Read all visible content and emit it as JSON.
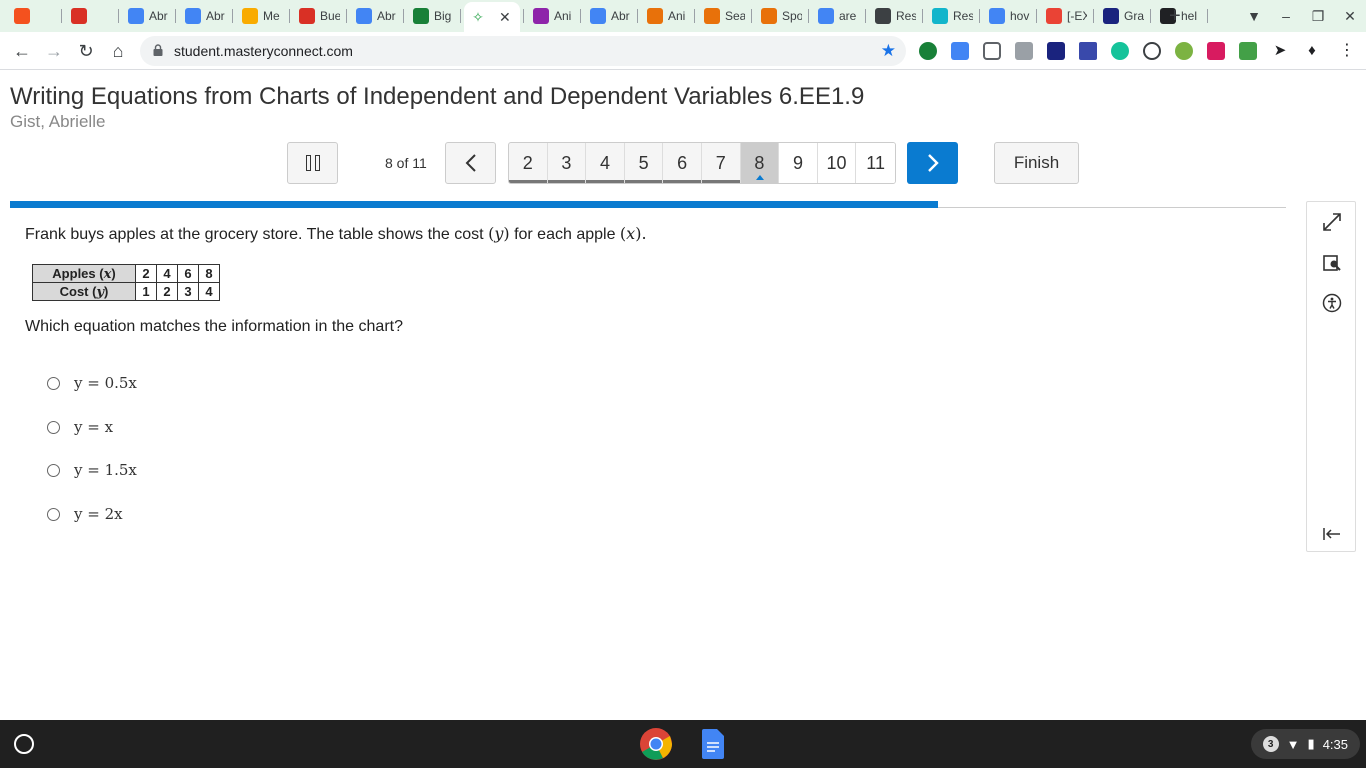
{
  "browser": {
    "tabs": [
      {
        "title": "",
        "icon": "orange-swirl-icon",
        "color": "#f4511e"
      },
      {
        "title": "",
        "icon": "record-icon",
        "color": "#d93025"
      },
      {
        "title": "Abr",
        "icon": "google-docs-icon",
        "color": "#4285f4"
      },
      {
        "title": "Abr",
        "icon": "google-docs-icon",
        "color": "#4285f4"
      },
      {
        "title": "Me",
        "icon": "f-logo-icon",
        "color": "#f9ab00"
      },
      {
        "title": "Bue",
        "icon": "acrobat-icon",
        "color": "#d93025"
      },
      {
        "title": "Abr",
        "icon": "google-docs-icon",
        "color": "#4285f4"
      },
      {
        "title": "Big",
        "icon": "bigideas-icon",
        "color": "#188038"
      },
      {
        "title": "",
        "icon": "masteryconnect-icon",
        "color": "#34a853"
      },
      {
        "title": "Ani",
        "icon": "person-icon",
        "color": "#8e24aa"
      },
      {
        "title": "Abr",
        "icon": "google-docs-icon",
        "color": "#4285f4"
      },
      {
        "title": "Ani",
        "icon": "office-icon",
        "color": "#e8710a"
      },
      {
        "title": "Sea",
        "icon": "office-icon",
        "color": "#e8710a"
      },
      {
        "title": "Spo",
        "icon": "office-icon",
        "color": "#e8710a"
      },
      {
        "title": "are",
        "icon": "google-icon",
        "color": "#4285f4"
      },
      {
        "title": "Res",
        "icon": "arrow-icon",
        "color": "#3c4043"
      },
      {
        "title": "Res",
        "icon": "r-logo-icon",
        "color": "#12b5cb"
      },
      {
        "title": "hov",
        "icon": "google-icon",
        "color": "#4285f4"
      },
      {
        "title": "[-EX",
        "icon": "gmail-icon",
        "color": "#ea4335"
      },
      {
        "title": "Gra",
        "icon": "sis-icon",
        "color": "#1a237e"
      },
      {
        "title": "hel",
        "icon": "b-logo-icon",
        "color": "#202124"
      }
    ],
    "url": "student.masteryconnect.com"
  },
  "assessment": {
    "title": "Writing Equations from Charts of Independent and Dependent Variables 6.EE1.9",
    "student": "Gist, Abrielle",
    "counter": "8 of 11",
    "pages": [
      "2",
      "3",
      "4",
      "5",
      "6",
      "7",
      "8",
      "9",
      "10",
      "11"
    ],
    "current_page": "8",
    "finish_label": "Finish",
    "progress_fraction": 0.727
  },
  "question": {
    "stem_a": "Frank buys apples at the grocery store. The table shows the cost",
    "var_y": "y",
    "stem_b": "for each apple",
    "var_x": "x",
    "table": {
      "row1_label_a": "Apples (",
      "row1_var": "x",
      "row1_label_b": ")",
      "row1_values": [
        "2",
        "4",
        "6",
        "8"
      ],
      "row2_label_a": "Cost (",
      "row2_var": "y",
      "row2_label_b": ")",
      "row2_values": [
        "1",
        "2",
        "3",
        "4"
      ]
    },
    "prompt": "Which equation matches the information in the chart?",
    "choices": [
      "y = 0.5x",
      "y = x",
      "y = 1.5x",
      "y = 2x"
    ]
  },
  "tools": [
    "expand-icon",
    "magnifier-icon",
    "accessibility-icon",
    "collapse-panel-icon"
  ],
  "system": {
    "notification_count": "3",
    "time": "4:35"
  },
  "colors": {
    "accent": "#0a7bd0",
    "tabstrip": "#e6f4ea",
    "shelf": "#202020"
  }
}
